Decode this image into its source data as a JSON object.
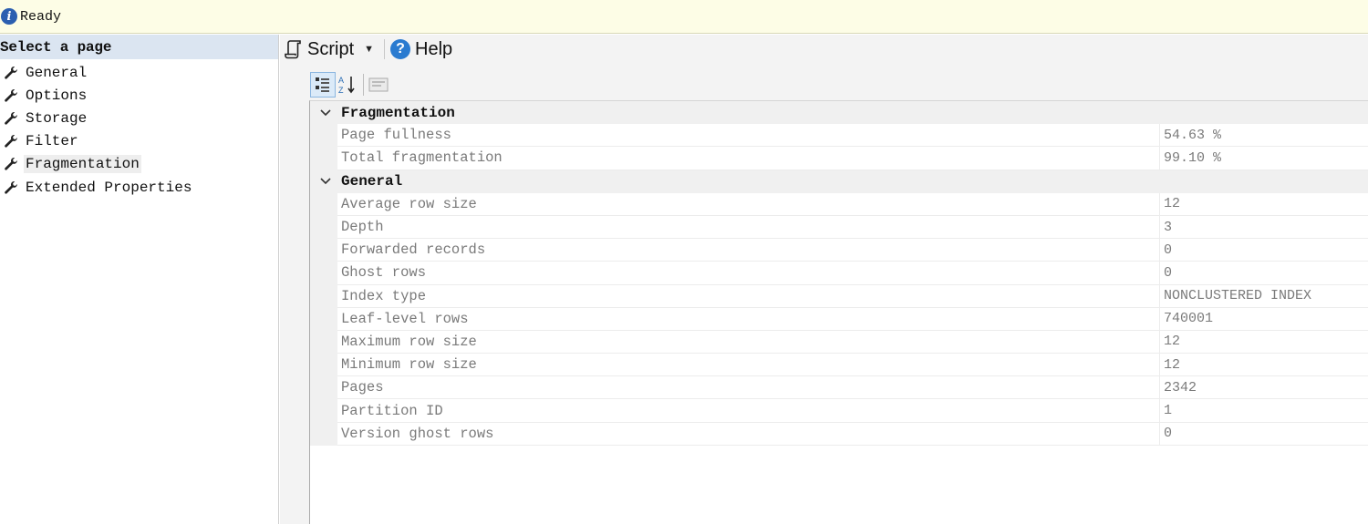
{
  "status": {
    "text": "Ready"
  },
  "left_panel": {
    "header": "Select a page",
    "pages": [
      {
        "label": "General"
      },
      {
        "label": "Options"
      },
      {
        "label": "Storage"
      },
      {
        "label": "Filter"
      },
      {
        "label": "Fragmentation",
        "selected": true
      },
      {
        "label": "Extended Properties"
      }
    ]
  },
  "toolbar": {
    "script_label": "Script",
    "help_label": "Help"
  },
  "property_grid": {
    "categories": [
      {
        "name": "Fragmentation",
        "rows": [
          {
            "name": "Page fullness",
            "value": "54.63 %"
          },
          {
            "name": "Total fragmentation",
            "value": "99.10 %"
          }
        ]
      },
      {
        "name": "General",
        "rows": [
          {
            "name": "Average row size",
            "value": "12"
          },
          {
            "name": "Depth",
            "value": "3"
          },
          {
            "name": "Forwarded records",
            "value": "0"
          },
          {
            "name": "Ghost rows",
            "value": "0"
          },
          {
            "name": "Index type",
            "value": "NONCLUSTERED INDEX"
          },
          {
            "name": "Leaf-level rows",
            "value": "740001"
          },
          {
            "name": "Maximum row size",
            "value": "12"
          },
          {
            "name": "Minimum row size",
            "value": "12"
          },
          {
            "name": "Pages",
            "value": "2342"
          },
          {
            "name": "Partition ID",
            "value": "1"
          },
          {
            "name": "Version ghost rows",
            "value": "0"
          }
        ]
      }
    ]
  }
}
